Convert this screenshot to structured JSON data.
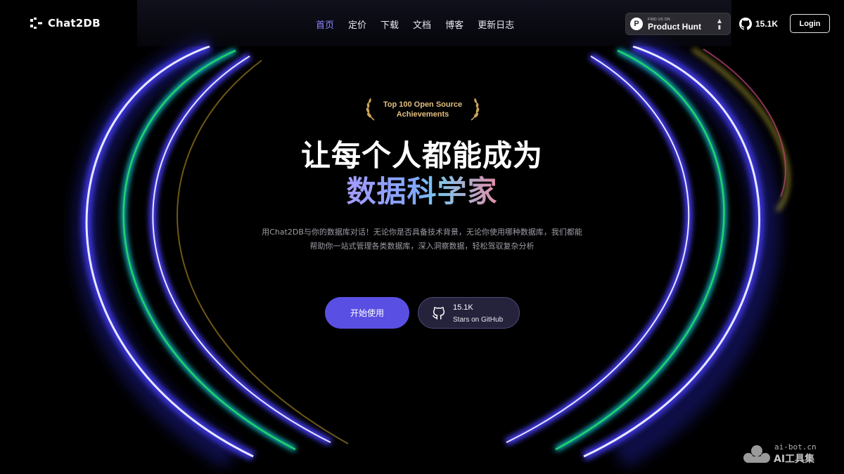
{
  "header": {
    "logo_text": "Chat2DB",
    "nav": [
      {
        "label": "首页",
        "active": true
      },
      {
        "label": "定价",
        "active": false
      },
      {
        "label": "下载",
        "active": false
      },
      {
        "label": "文档",
        "active": false
      },
      {
        "label": "博客",
        "active": false
      },
      {
        "label": "更新日志",
        "active": false
      }
    ],
    "product_hunt": {
      "small_text": "FIND US ON",
      "name": "Product Hunt"
    },
    "github_stars": "15.1K",
    "login_label": "Login"
  },
  "hero": {
    "award_line1": "Top 100 Open Source",
    "award_line2": "Achievements",
    "headline_line1": "让每个人都能成为",
    "headline_line2": "数据科学家",
    "subtitle_line1": "用Chat2DB与你的数据库对话！无论你是否具备技术背景，无论你使用哪种数据库，我们都能",
    "subtitle_line2": "帮助你一站式管理各类数据库，深入洞察数据，轻松驾驭复杂分析",
    "start_button": "开始使用",
    "github_count": "15.1K",
    "github_label": "Stars on GitHub"
  },
  "watermark": {
    "url": "ai-bot.cn",
    "name": "AI工具集"
  },
  "colors": {
    "accent": "#5a4fe3",
    "active_nav": "#8f86ff",
    "award_gold": "#e3bf7f"
  },
  "icons": [
    "chat2db-logo-icon",
    "product-hunt-icon",
    "upvote-arrows-icon",
    "github-icon",
    "laurel-left-icon",
    "laurel-right-icon"
  ]
}
